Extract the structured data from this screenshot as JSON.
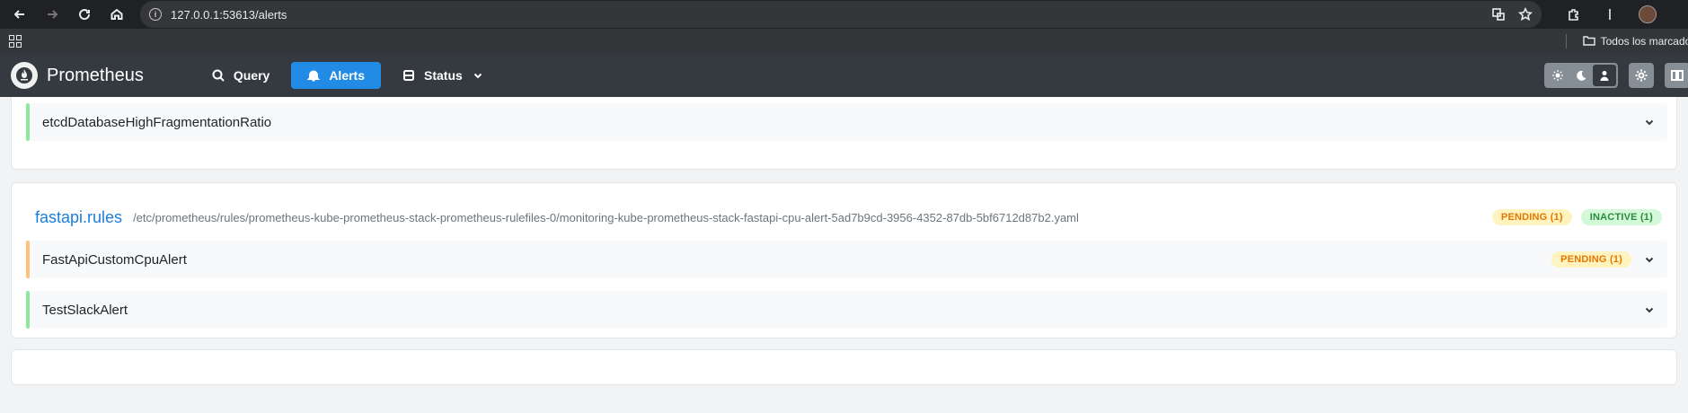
{
  "browser": {
    "url": "127.0.0.1:53613/alerts",
    "bookmarks_label": "Todos los marcadores"
  },
  "app": {
    "brand": "Prometheus",
    "nav": [
      {
        "label": "Query",
        "icon": "search-icon"
      },
      {
        "label": "Alerts",
        "icon": "bell-icon",
        "active": true
      },
      {
        "label": "Status",
        "icon": "server-icon"
      }
    ],
    "theme_options": [
      "sun-icon",
      "moon-icon",
      "user-icon"
    ]
  },
  "groups": [
    {
      "rules": [
        {
          "name": "etcdDatabaseHighFragmentationRatio",
          "state": "inactive"
        }
      ]
    },
    {
      "title": "fastapi.rules",
      "path": "/etc/prometheus/rules/prometheus-kube-prometheus-stack-prometheus-rulefiles-0/monitoring-kube-prometheus-stack-fastapi-cpu-alert-5ad7b9cd-3956-4352-87db-5bf6712d87b2.yaml",
      "badges": [
        {
          "label": "PENDING (1)",
          "type": "pending"
        },
        {
          "label": "INACTIVE (1)",
          "type": "inactive"
        }
      ],
      "rules": [
        {
          "name": "FastApiCustomCpuAlert",
          "state": "pending",
          "badge": "PENDING (1)"
        },
        {
          "name": "TestSlackAlert",
          "state": "inactive"
        }
      ]
    }
  ],
  "colors": {
    "header_bg": "#343a40",
    "accent": "#228be6",
    "inactive_bar": "#8ce99a",
    "pending_bar": "#ffc078"
  }
}
